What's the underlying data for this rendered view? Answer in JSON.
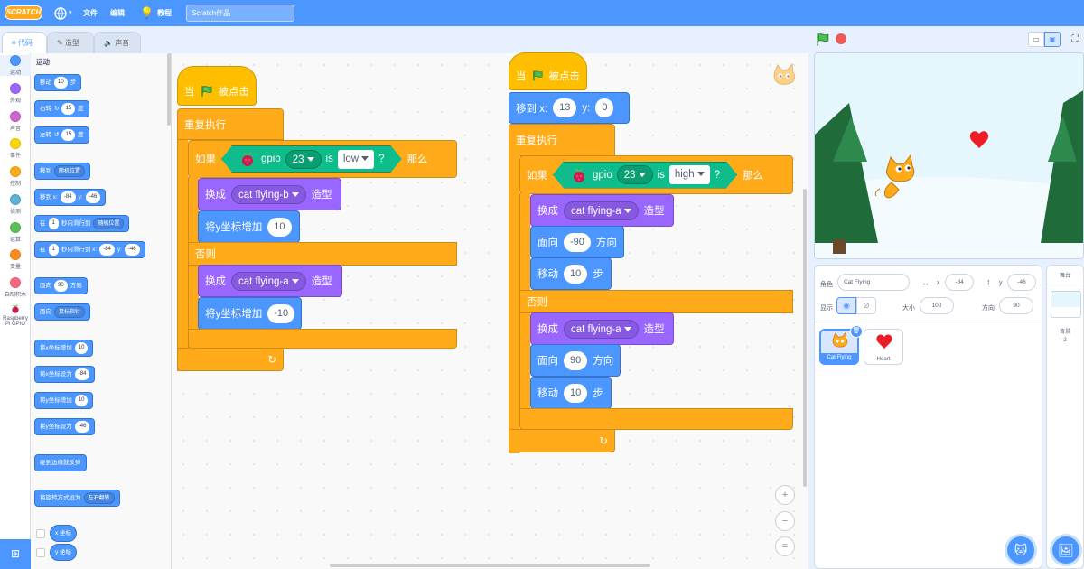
{
  "menubar": {
    "logo": "SCRATCH",
    "file": "文件",
    "edit": "编辑",
    "tutorials": "教程",
    "project_title": "Scratch作品"
  },
  "tabs": {
    "code": "代码",
    "costumes": "造型",
    "sounds": "声音"
  },
  "categories": [
    {
      "label": "运动",
      "color": "#4c97ff"
    },
    {
      "label": "外观",
      "color": "#9966ff"
    },
    {
      "label": "声音",
      "color": "#cf63cf"
    },
    {
      "label": "事件",
      "color": "#ffd500"
    },
    {
      "label": "控制",
      "color": "#ffab19"
    },
    {
      "label": "侦测",
      "color": "#5cb1d6"
    },
    {
      "label": "运算",
      "color": "#59c059"
    },
    {
      "label": "变量",
      "color": "#ff8c1a"
    },
    {
      "label": "自制积木",
      "color": "#ff6680"
    },
    {
      "label": "Raspberry Pi GPIO",
      "color": "#333333"
    }
  ],
  "palette": {
    "heading": "运动",
    "move": "移动",
    "move_val": "10",
    "steps": "步",
    "turn_right": "右转",
    "turn_val": "15",
    "deg": "度",
    "turn_left": "左转",
    "goto": "移到",
    "goto_dd": "随机位置",
    "gotoxy": "移到 x:",
    "x_val": "-84",
    "y": "y:",
    "y_val": "-46",
    "glide": "在",
    "glide_secs": "1",
    "glide_mid": "秒内滑行到",
    "glide_dd": "随机位置",
    "glide2_mid": "秒内滑行到 x:",
    "point": "面向",
    "point_val": "90",
    "direction": "方向",
    "point_towards": "面向",
    "point_dd": "鼠标指针",
    "changex": "将x坐标增加",
    "changex_val": "10",
    "setx": "将x坐标设为",
    "setx_val": "-84",
    "changey": "将y坐标增加",
    "changey_val": "10",
    "sety": "将y坐标设为",
    "sety_val": "-46",
    "bounce": "碰到边缘就反弹",
    "rotstyle": "将旋转方式设为",
    "rotstyle_dd": "左右翻转",
    "xpos": "x 坐标",
    "ypos": "y 坐标"
  },
  "script1": {
    "when": "当",
    "clicked": "被点击",
    "forever": "重复执行",
    "if": "如果",
    "then": "那么",
    "else": "否则",
    "gpio": "gpio",
    "pin": "23",
    "is": "is",
    "state": "low",
    "q": "?",
    "switch": "换成",
    "costume_b": "cat flying-b",
    "costume_word": "造型",
    "changey": "将y坐标增加",
    "up_val": "10",
    "costume_a": "cat flying-a",
    "down_val": "-10"
  },
  "script2": {
    "when": "当",
    "clicked": "被点击",
    "goto": "移到 x:",
    "x_val": "13",
    "y": "y:",
    "y_val": "0",
    "forever": "重复执行",
    "if": "如果",
    "then": "那么",
    "else": "否则",
    "gpio": "gpio",
    "pin": "23",
    "is": "is",
    "state": "high",
    "q": "?",
    "switch": "换成",
    "costume_a": "cat flying-a",
    "costume_word": "造型",
    "point": "面向",
    "dir1": "-90",
    "direction": "方向",
    "move": "移动",
    "steps_val": "10",
    "steps": "步",
    "dir2": "90"
  },
  "sprite_info": {
    "sprite_label": "角色",
    "sprite_name": "Cat Flying",
    "x_label": "x",
    "x": "-84",
    "y_label": "y",
    "y": "-46",
    "show_label": "显示",
    "size_label": "大小",
    "size": "100",
    "dir_label": "方向",
    "dir": "90"
  },
  "sprites": [
    {
      "name": "Cat Flying"
    },
    {
      "name": "Heart"
    }
  ],
  "stage_panel": {
    "title": "舞台",
    "backdrops_label": "背景",
    "backdrops_count": "2"
  },
  "zoom": {
    "in": "+",
    "out": "−",
    "reset": "="
  }
}
